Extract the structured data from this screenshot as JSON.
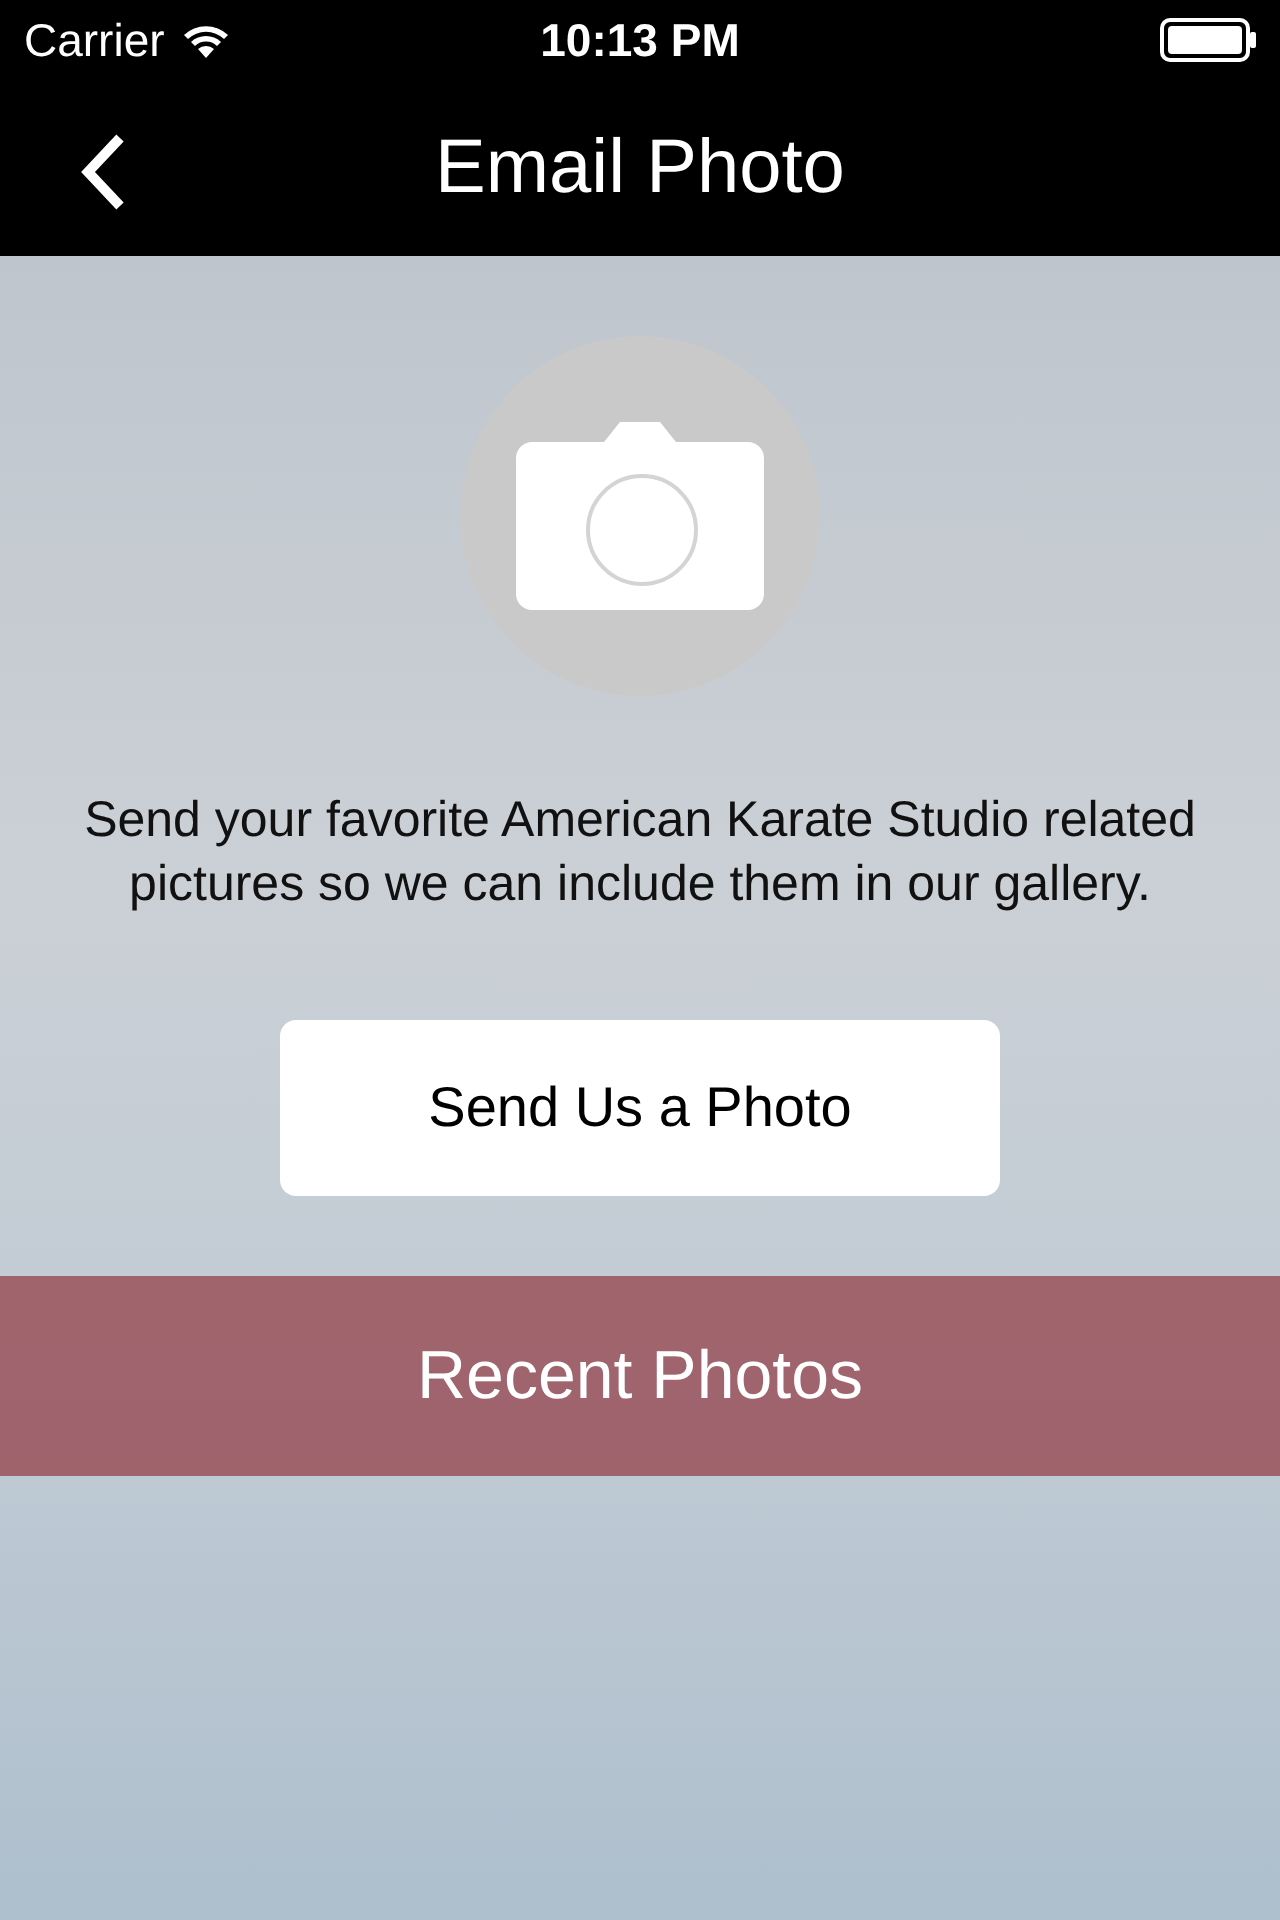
{
  "status_bar": {
    "carrier": "Carrier",
    "time": "10:13 PM"
  },
  "nav_bar": {
    "title": "Email Photo"
  },
  "intro": "Send your favorite American Karate Studio related pictures so we can include them in our gallery.",
  "send_button": "Send Us a Photo",
  "section_header": "Recent Photos"
}
